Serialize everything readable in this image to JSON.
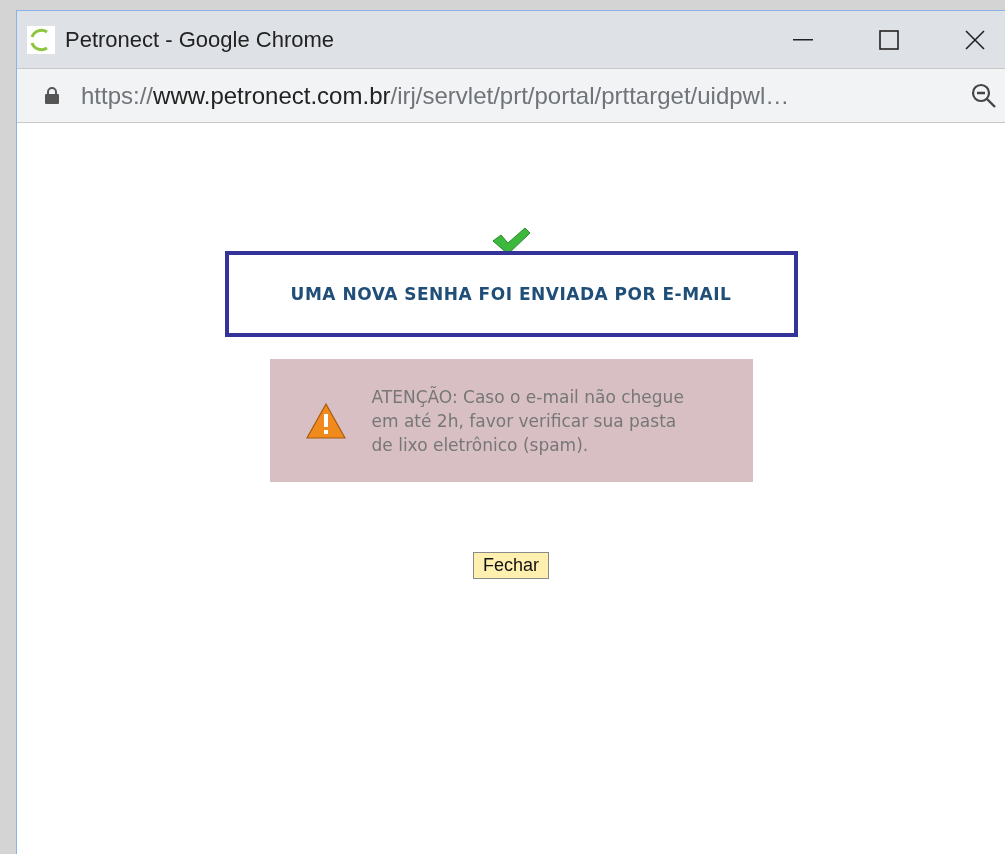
{
  "window": {
    "title": "Petronect - Google Chrome"
  },
  "address_bar": {
    "scheme": "https://",
    "host": "www.petronect.com.br",
    "path": "/irj/servlet/prt/portal/prttarget/uidpwl…"
  },
  "message": {
    "heading": "UMA NOVA SENHA FOI ENVIADA POR E-MAIL",
    "warning": "ATENÇÃO: Caso o e-mail não chegue em até 2h, favor verificar sua pasta de lixo eletrônico (spam)."
  },
  "buttons": [
    "Fechar"
  ]
}
